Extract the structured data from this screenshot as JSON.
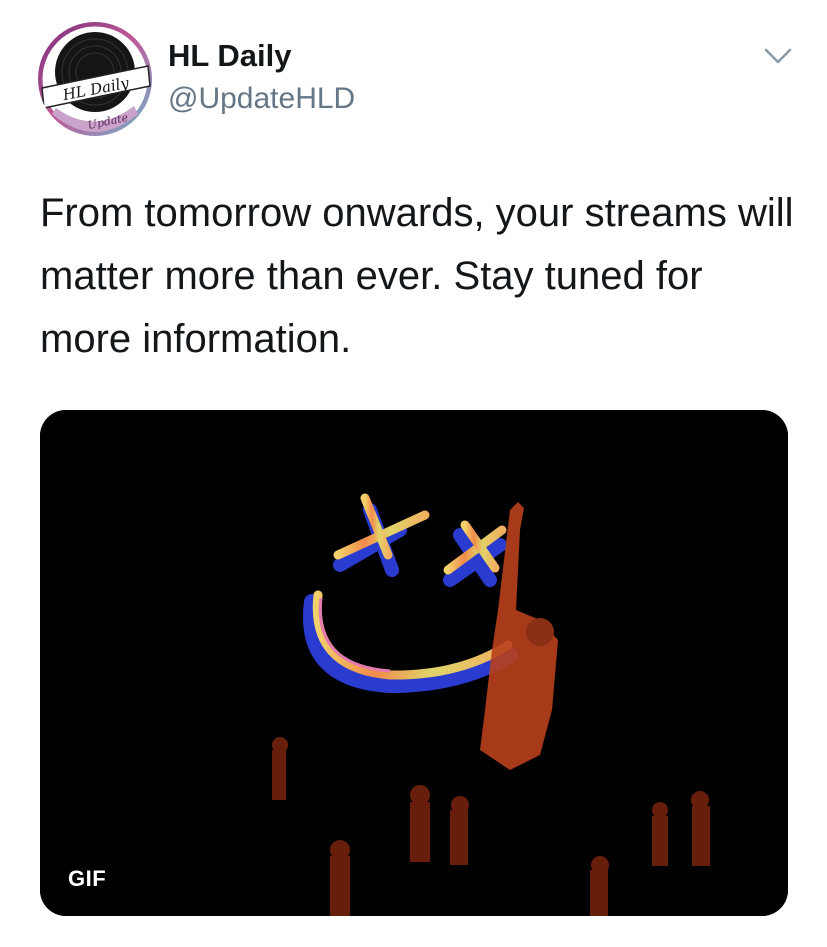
{
  "author": {
    "display_name": "HL Daily",
    "handle": "@UpdateHLD",
    "avatar_logo_text": "HL Daily",
    "avatar_logo_subtext": "Update"
  },
  "tweet": {
    "text": "From tomorrow onwards, your streams will matter more than ever. Stay tuned for more information."
  },
  "media": {
    "badge": "GIF",
    "description_icon": "smiley-face-neon-concert"
  },
  "icons": {
    "menu": "chevron-down-icon"
  },
  "colors": {
    "text_primary": "#14171a",
    "text_secondary": "#657786",
    "media_bg": "#000000"
  }
}
